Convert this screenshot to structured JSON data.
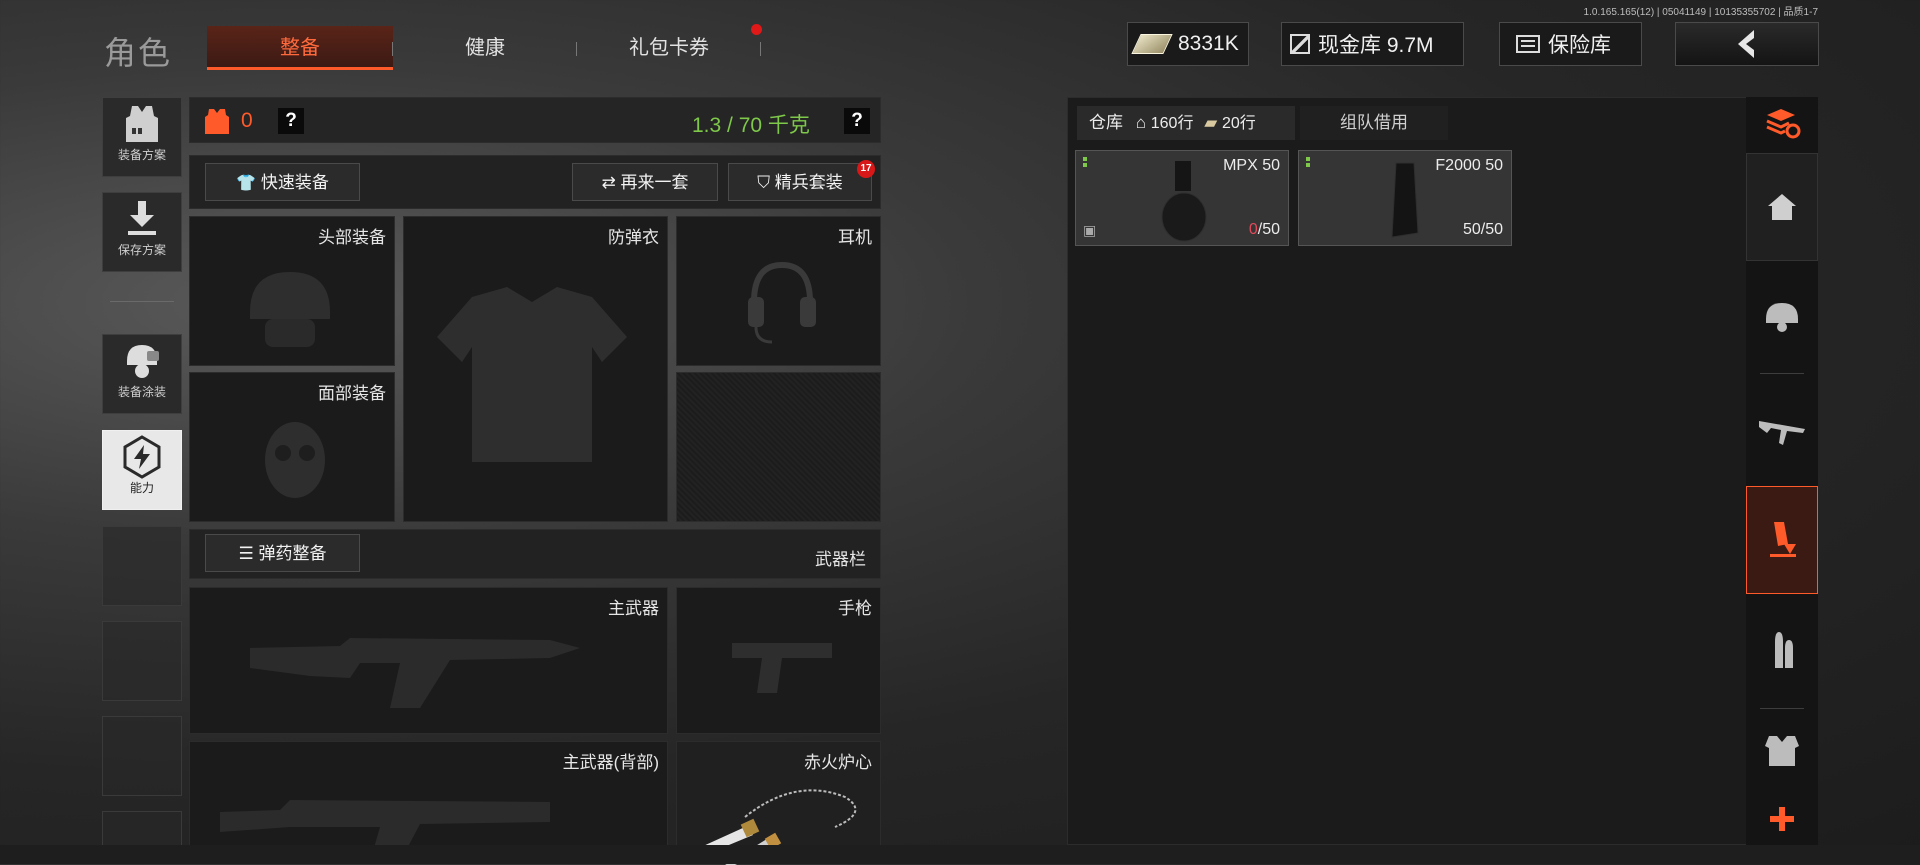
{
  "version": "1.0.165.165(12) | 05041149 | 10135355702 | 品质1-7",
  "header": {
    "title": "角色",
    "tabs": [
      {
        "label": "整备",
        "active": true
      },
      {
        "label": "健康",
        "active": false
      },
      {
        "label": "礼包卡券",
        "active": false,
        "notify": true
      }
    ],
    "money": "8331K",
    "cash_vault": "现金库 9.7M",
    "safe_box": "保险库",
    "colors": {
      "accent": "#ff5a2a",
      "capacity_green": "#7ec84a",
      "notify_red": "#e01818"
    }
  },
  "sidebar": {
    "items": [
      {
        "label": "装备方案",
        "icon": "vest-icon"
      },
      {
        "label": "保存方案",
        "icon": "download-icon"
      },
      {
        "label": "装备涂装",
        "icon": "helmet-paint-icon"
      },
      {
        "label": "能力",
        "icon": "ability-icon"
      }
    ]
  },
  "loadout": {
    "armor_value": "0",
    "help": "?",
    "weight": "1.3 / 70 千克",
    "quick_equip": "快速装备",
    "redo_set": "再来一套",
    "elite_set": "精兵套装",
    "elite_badge": "17",
    "slots": {
      "head": "头部装备",
      "armor": "防弹衣",
      "earphone": "耳机",
      "face": "面部装备",
      "primary": "主武器",
      "pistol": "手枪",
      "primary_back": "主武器(背部)",
      "melee": "赤火炉心"
    },
    "ammo_prep": "弹药整备",
    "weapon_bar": "武器栏"
  },
  "storage": {
    "tab_warehouse": "仓库",
    "rows_home": "160行",
    "rows_extra": "20行",
    "tab_team": "组队借用",
    "items": [
      {
        "name": "MPX 50",
        "count_have": "0",
        "count_total": "/50"
      },
      {
        "name": "F2000 50",
        "count": "50/50"
      }
    ]
  },
  "right_nav": {
    "icons": [
      "layers-refresh-icon",
      "home-icon",
      "helmet-icon",
      "rifle-icon",
      "magazine-icon",
      "ammo-icon",
      "armor-icon",
      "plus-icon"
    ]
  }
}
